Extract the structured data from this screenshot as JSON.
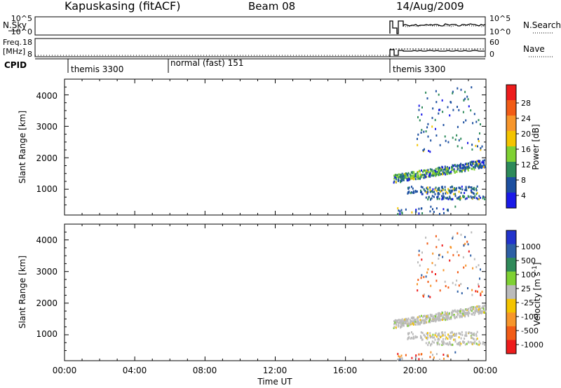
{
  "header": {
    "station_title": "Kapuskasing (fitACF)",
    "beam": "Beam 08",
    "date": "14/Aug/2009"
  },
  "top_panels": {
    "nsky_label": "N.Sky",
    "nsky_ticks": [
      "10^5",
      "10^0"
    ],
    "nsearch_label": "N.Search",
    "nsearch_ticks": [
      "10^5",
      "10^0"
    ],
    "freq_label_line1": "Freq.",
    "freq_label_line2": "[MHz]",
    "freq_ticks": [
      "18",
      "8"
    ],
    "nave_label": "Nave",
    "nave_ticks": [
      "60",
      "0"
    ],
    "cpid_label": "CPID",
    "cpid_segments": [
      {
        "label": "themis 3300",
        "start_hour": 0.9,
        "end_hour": 6.0
      },
      {
        "label": "normal (fast) 151",
        "start_hour": 6.0,
        "end_hour": 18.6
      },
      {
        "label": "themis 3300",
        "start_hour": 18.6,
        "end_hour": 24.0
      }
    ]
  },
  "axes": {
    "x_ticks": [
      "00:00",
      "04:00",
      "08:00",
      "12:00",
      "16:00",
      "20:00",
      "00:00"
    ],
    "x_label": "Time UT",
    "y_label": "Slant Range [km]",
    "y_ticks": [
      "1000",
      "2000",
      "3000",
      "4000"
    ]
  },
  "chart_data": [
    {
      "type": "heatmap",
      "title": "",
      "xlabel": "Time UT",
      "ylabel": "Slant Range [km]",
      "xlim_hours": [
        0,
        24
      ],
      "ylim_km": [
        180,
        4500
      ],
      "colorbar_label": "Power [dB]",
      "colorbar_ticks": [
        "28",
        "24",
        "20",
        "16",
        "12",
        "8",
        "4"
      ],
      "colorbar_colors": [
        "#ee1c1c",
        "#f25c16",
        "#f7962b",
        "#f4c400",
        "#7fd133",
        "#2d8a5a",
        "#1c4fa0",
        "#1a1ae8"
      ],
      "data_extent": {
        "start_hour": 18.6,
        "end_hour": 24.0
      },
      "features": [
        {
          "desc": "main band",
          "t": [
            18.7,
            24.0
          ],
          "range_km": [
            1300,
            1850
          ]
        },
        {
          "desc": "lower band",
          "t": [
            19.5,
            23.5
          ],
          "range_km": [
            900,
            1200
          ]
        },
        {
          "desc": "near range",
          "t": [
            20.5,
            24.0
          ],
          "range_km": [
            700,
            850
          ]
        },
        {
          "desc": "scattered far echoes",
          "t": [
            20.0,
            23.8
          ],
          "range_km": [
            2200,
            4300
          ]
        }
      ]
    },
    {
      "type": "heatmap",
      "title": "",
      "xlabel": "Time UT",
      "ylabel": "Slant Range [km]",
      "xlim_hours": [
        0,
        24
      ],
      "ylim_km": [
        180,
        4500
      ],
      "colorbar_label": "Velocity [m s^-1]",
      "colorbar_ticks": [
        "1000",
        "500",
        "100",
        "25",
        "-25",
        "-100",
        "-500",
        "-1000"
      ],
      "colorbar_colors": [
        "#2233cc",
        "#2d5fa5",
        "#2f8a5a",
        "#7fd133",
        "#bbbbbb",
        "#f4c400",
        "#f7962b",
        "#f25c16",
        "#ee1c1c"
      ],
      "data_extent": {
        "start_hour": 18.6,
        "end_hour": 24.0
      },
      "features": [
        {
          "desc": "main band (ground scatter)",
          "t": [
            18.7,
            24.0
          ],
          "range_km": [
            1300,
            1850
          ]
        },
        {
          "desc": "lower band",
          "t": [
            19.5,
            23.5
          ],
          "range_km": [
            900,
            1200
          ]
        },
        {
          "desc": "near range",
          "t": [
            20.5,
            24.0
          ],
          "range_km": [
            700,
            850
          ]
        },
        {
          "desc": "scattered far echoes",
          "t": [
            20.0,
            23.8
          ],
          "range_km": [
            2200,
            4300
          ]
        }
      ]
    }
  ]
}
